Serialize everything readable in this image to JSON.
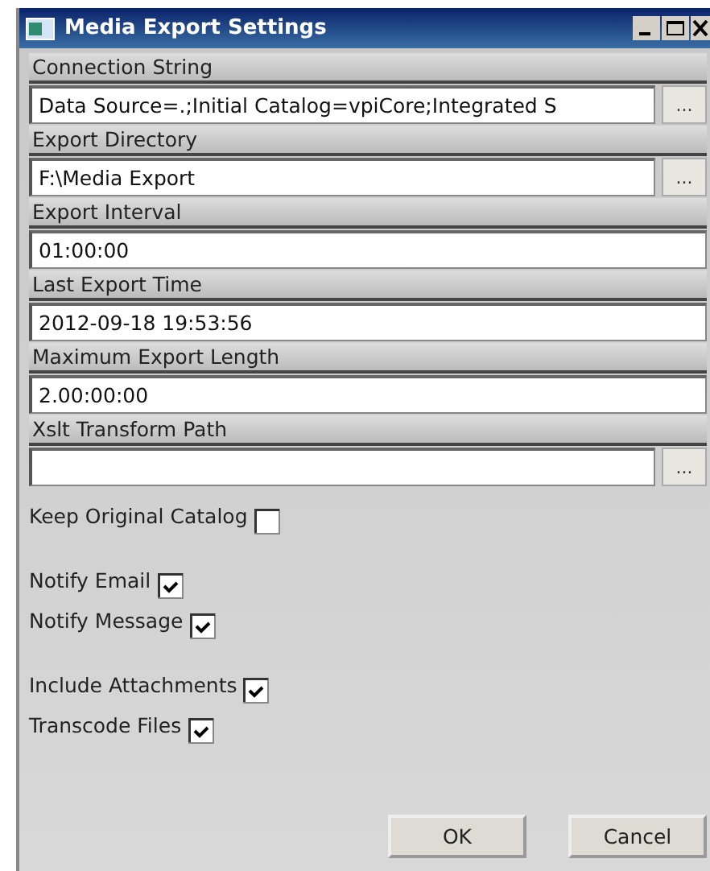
{
  "window": {
    "title": "Media Export Settings"
  },
  "fields": [
    {
      "label": "Connection String",
      "value": "Data Source=.;Initial Catalog=vpiCore;Integrated S",
      "browse": "..."
    },
    {
      "label": "Export Directory",
      "value": "F:\\Media Export",
      "browse": "..."
    },
    {
      "label": "Export Interval",
      "value": "01:00:00"
    },
    {
      "label": "Last Export Time",
      "value": "2012-09-18 19:53:56"
    },
    {
      "label": "Maximum Export Length",
      "value": "2.00:00:00"
    },
    {
      "label": "Xslt Transform Path",
      "browse": "..."
    }
  ],
  "checkbox_groups": [
    [
      {
        "label": "Keep Original Catalog",
        "checked": false
      }
    ],
    [
      {
        "label": "Notify Email",
        "checked": true
      },
      {
        "label": "Notify Message",
        "checked": true
      }
    ],
    [
      {
        "label": "Include Attachments",
        "checked": true
      },
      {
        "label": "Transcode Files",
        "checked": true
      }
    ]
  ],
  "buttons": [
    "OK",
    "Cancel"
  ]
}
